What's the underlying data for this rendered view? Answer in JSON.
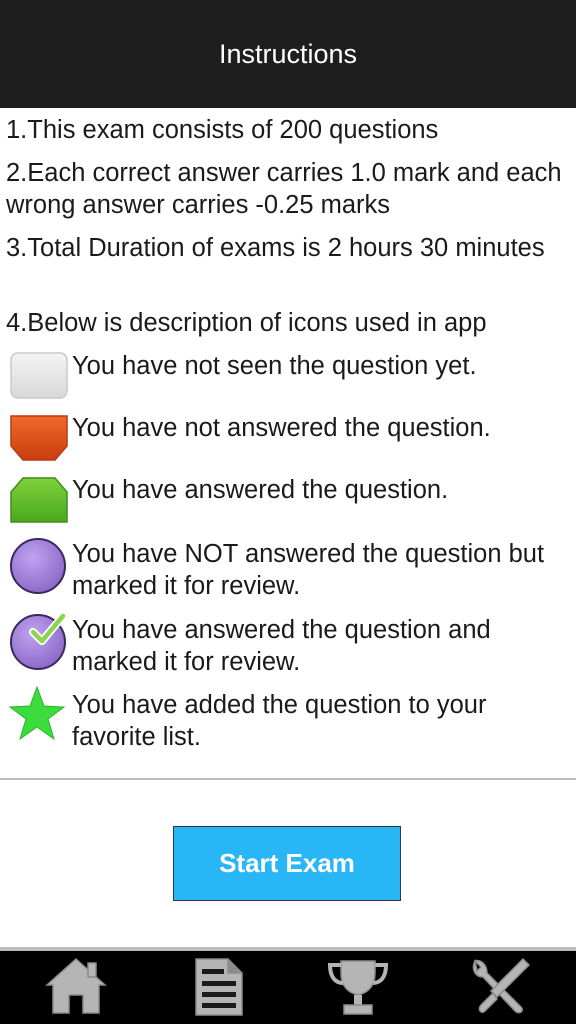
{
  "header": {
    "title": "Instructions"
  },
  "instructions": [
    "1.This exam consists of 200 questions",
    "2.Each correct answer carries 1.0 mark and each wrong answer carries -0.25 marks",
    "3.Total Duration of exams is 2 hours 30 minutes",
    "4.Below is description of icons used in app"
  ],
  "legend": [
    {
      "icon": "not-seen-icon",
      "color": "#e6e6e6",
      "text": "You have not seen the question yet."
    },
    {
      "icon": "not-answered-icon",
      "color": "#e8501a",
      "text": "You have not answered the question."
    },
    {
      "icon": "answered-icon",
      "color": "#5cb82b",
      "text": "You have answered the question."
    },
    {
      "icon": "marked-review-icon",
      "color": "#a07fd6",
      "text": "You have NOT answered the question but marked it for review."
    },
    {
      "icon": "answered-marked-review-icon",
      "color": "#a07fd6",
      "text": "You have answered the question and marked it for review."
    },
    {
      "icon": "favorite-star-icon",
      "color": "#3ddc3d",
      "text": "You have added the question to your favorite list."
    }
  ],
  "start_button": {
    "label": "Start Exam",
    "color": "#29b6f6"
  },
  "bottom_nav": [
    {
      "icon": "home-icon"
    },
    {
      "icon": "document-icon"
    },
    {
      "icon": "trophy-icon"
    },
    {
      "icon": "tools-icon"
    }
  ]
}
